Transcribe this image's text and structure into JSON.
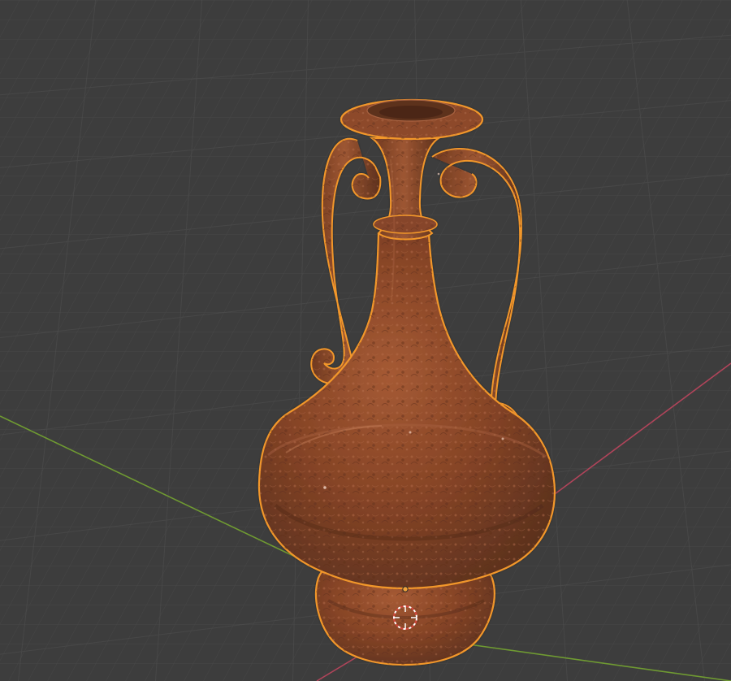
{
  "viewport": {
    "mode": "3d-viewport",
    "background_color": "#3d3d3d",
    "grid_color": "#4b4b4b",
    "x_axis_color": "#b0445a",
    "y_axis_color": "#6f9a32"
  },
  "object": {
    "type": "vase",
    "selected": true,
    "selection_outline_color": "#f2972a",
    "material_color": "#8a4a2b"
  },
  "icons": {
    "origin": "origin-point-icon",
    "cursor": "3d-cursor-icon"
  }
}
